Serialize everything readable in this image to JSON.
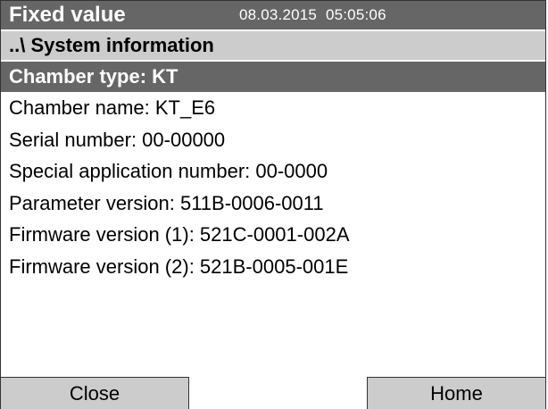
{
  "header": {
    "mode": "Fixed value",
    "date": "08.03.2015",
    "time": "05:05:06"
  },
  "breadcrumb": "..\\ System information",
  "selected_item": "Chamber type: KT",
  "items": [
    "Chamber name: KT_E6",
    "Serial number: 00-00000",
    "Special application number: 00-0000",
    "Parameter version: 511B-0006-0011",
    "Firmware version (1): 521C-0001-002A",
    "Firmware version (2): 521B-0005-001E"
  ],
  "buttons": {
    "close_label": "Close",
    "home_label": "Home"
  },
  "colors": {
    "dark_bar": "#666666",
    "light_bar": "#cccccc"
  }
}
